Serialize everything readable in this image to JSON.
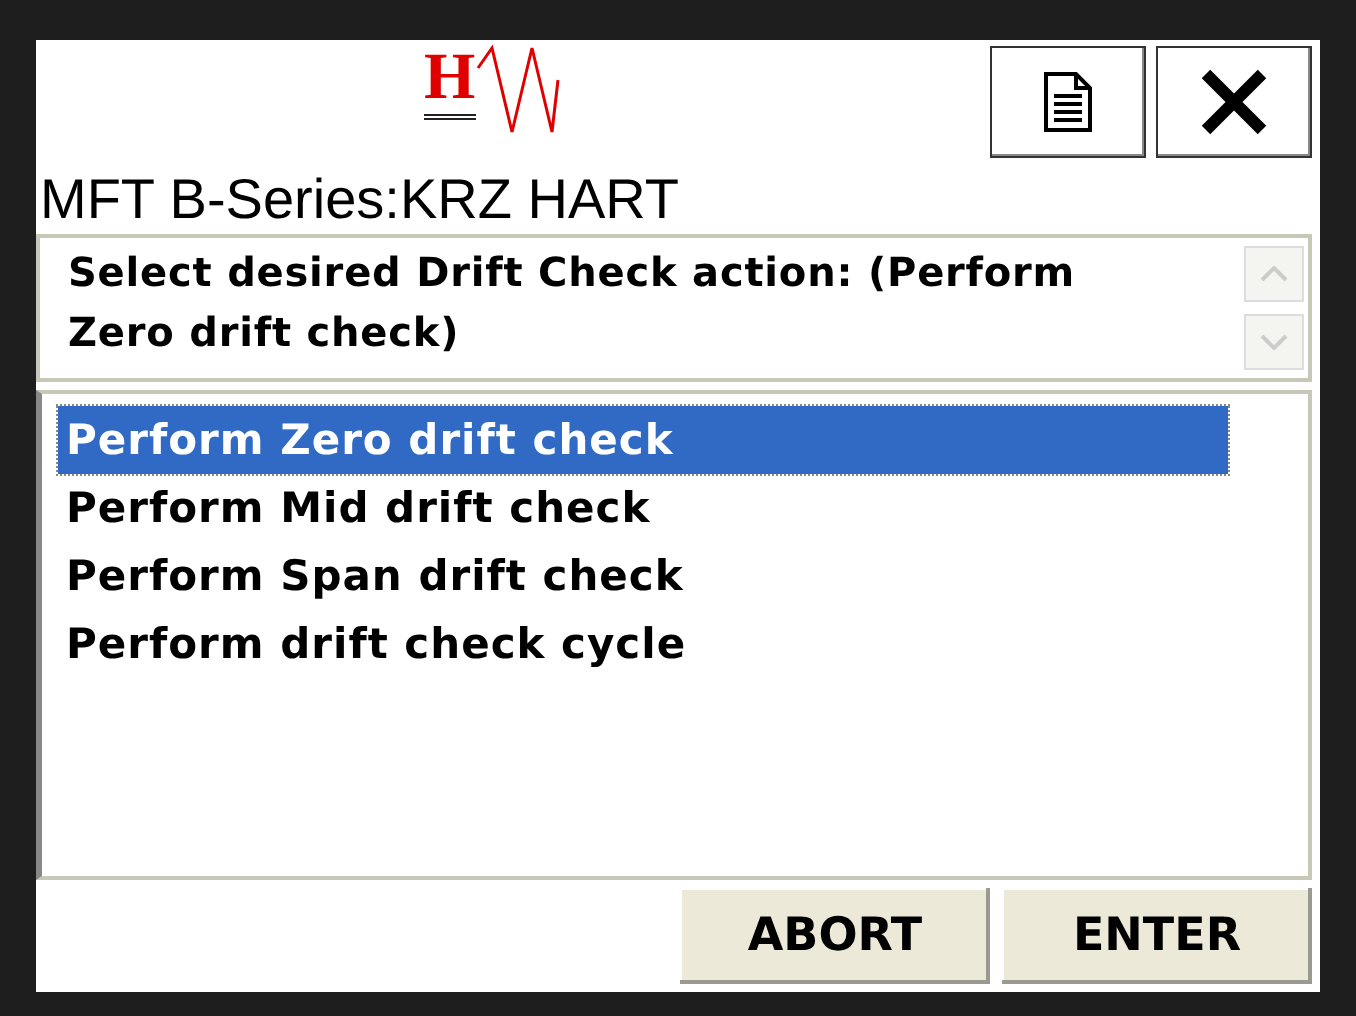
{
  "header": {
    "logo_text": "H",
    "buttons": [
      {
        "kind": "document"
      },
      {
        "kind": "close"
      }
    ]
  },
  "title": "MFT B-Series:KRZ HART",
  "prompt": {
    "text": "Select desired Drift Check action: (Perform Zero drift check)"
  },
  "options": [
    {
      "label": "Perform Zero drift check",
      "selected": true
    },
    {
      "label": "Perform Mid drift check",
      "selected": false
    },
    {
      "label": "Perform Span drift check",
      "selected": false
    },
    {
      "label": "Perform drift check cycle",
      "selected": false
    }
  ],
  "buttons": [
    "ABORT",
    "ENTER"
  ]
}
